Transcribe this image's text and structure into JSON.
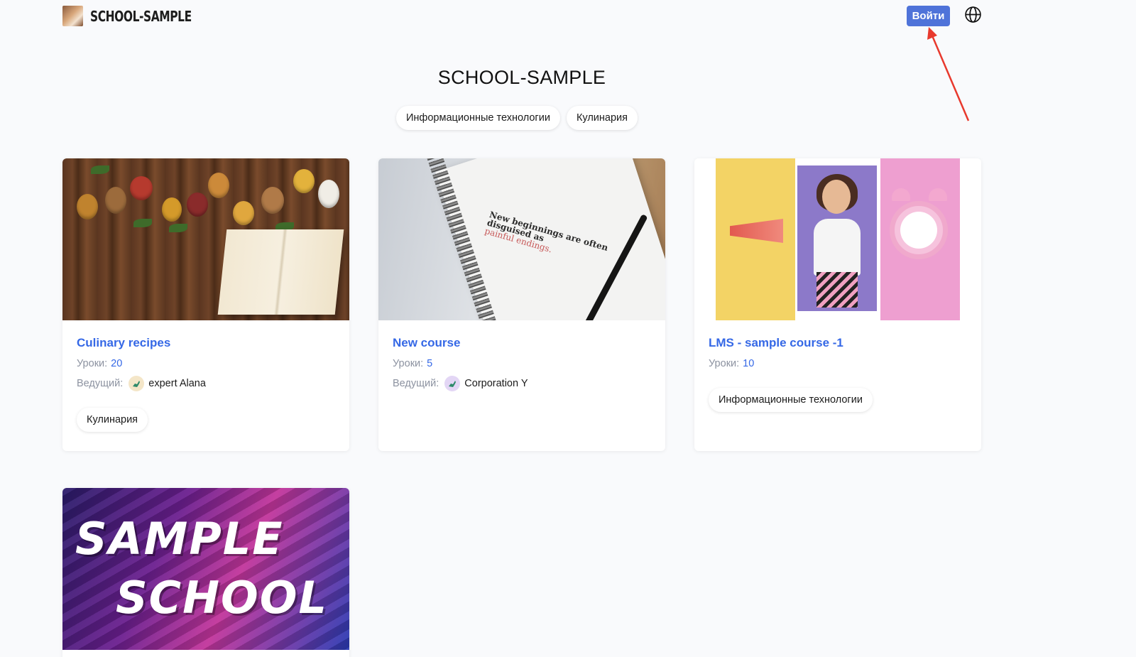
{
  "header": {
    "brand": "SCHOOL-SAMPLE",
    "login_label": "Войти",
    "language_icon": "globe-icon"
  },
  "page": {
    "title": "SCHOOL-SAMPLE",
    "filters": [
      "Информационные технологии",
      "Кулинария"
    ]
  },
  "labels": {
    "lessons": "Уроки:",
    "host": "Ведущий:"
  },
  "courses": [
    {
      "title": "Culinary recipes",
      "lessons": "20",
      "host": "expert Alana",
      "tag": "Кулинария"
    },
    {
      "title": "New course",
      "lessons": "5",
      "host": "Corporation Y",
      "image_text": [
        "New beginnings are often",
        "disguised as",
        "painful endings."
      ]
    },
    {
      "title": "LMS - sample course -1",
      "lessons": "10",
      "tag": "Информационные технологии"
    },
    {
      "image_text": [
        "SAMPLE",
        "SCHOOL"
      ]
    }
  ],
  "colors": {
    "accent": "#3568e6",
    "button": "#4f73d9",
    "annotation_arrow": "#e8392d",
    "background": "#f9fafc"
  }
}
